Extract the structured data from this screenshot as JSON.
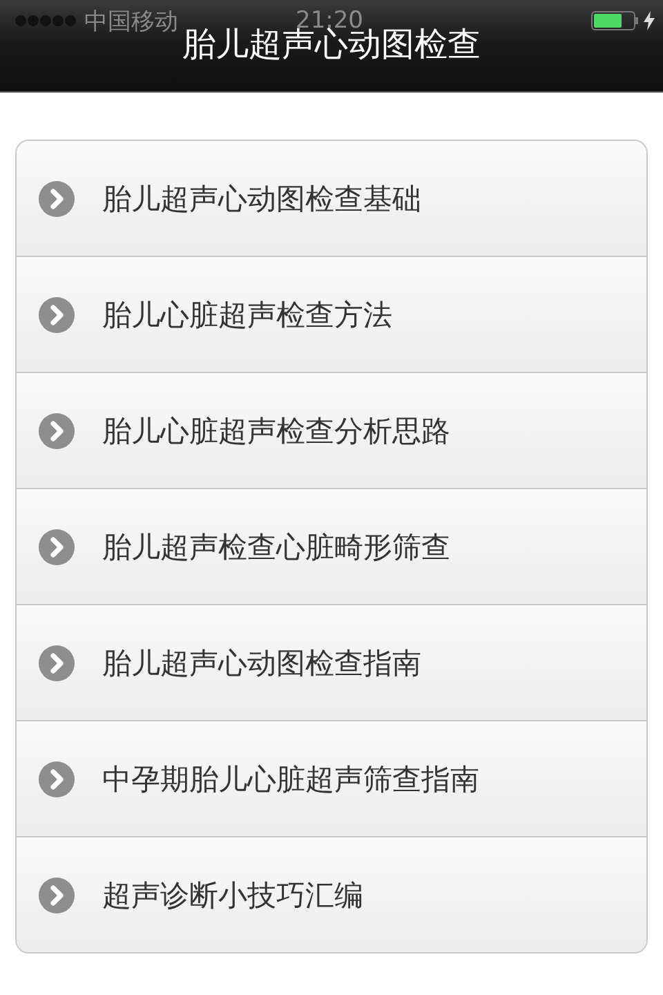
{
  "status_bar": {
    "carrier": "中国移动",
    "time": "21:20"
  },
  "nav_bar": {
    "title": "胎儿超声心动图检查"
  },
  "menu": {
    "items": [
      {
        "label": "胎儿超声心动图检查基础"
      },
      {
        "label": "胎儿心脏超声检查方法"
      },
      {
        "label": "胎儿心脏超声检查分析思路"
      },
      {
        "label": "胎儿超声检查心脏畸形筛查"
      },
      {
        "label": "胎儿超声心动图检查指南"
      },
      {
        "label": "中孕期胎儿心脏超声筛查指南"
      },
      {
        "label": "超声诊断小技巧汇编"
      }
    ]
  }
}
